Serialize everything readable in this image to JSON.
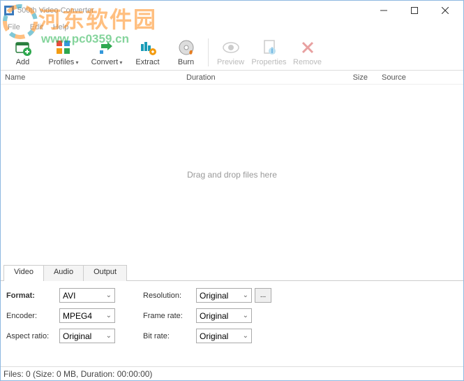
{
  "window": {
    "title": "500th Video Converter"
  },
  "menu": {
    "file": "File",
    "edit": "Edit",
    "help": "Help"
  },
  "toolbar": {
    "add": "Add",
    "profiles": "Profiles",
    "convert": "Convert",
    "extract": "Extract",
    "burn": "Burn",
    "preview": "Preview",
    "properties": "Properties",
    "remove": "Remove"
  },
  "columns": {
    "name": "Name",
    "duration": "Duration",
    "size": "Size",
    "source": "Source"
  },
  "dropzone": "Drag and drop files here",
  "tabs": {
    "video": "Video",
    "audio": "Audio",
    "output": "Output"
  },
  "video": {
    "format_label": "Format:",
    "format_value": "AVI",
    "encoder_label": "Encoder:",
    "encoder_value": "MPEG4",
    "aspect_label": "Aspect ratio:",
    "aspect_value": "Original",
    "resolution_label": "Resolution:",
    "resolution_value": "Original",
    "framerate_label": "Frame rate:",
    "framerate_value": "Original",
    "bitrate_label": "Bit rate:",
    "bitrate_value": "Original",
    "more": "..."
  },
  "status": "Files: 0 (Size: 0 MB, Duration: 00:00:00)",
  "watermark": {
    "text": "河东软件园",
    "url": "www.pc0359.cn"
  }
}
